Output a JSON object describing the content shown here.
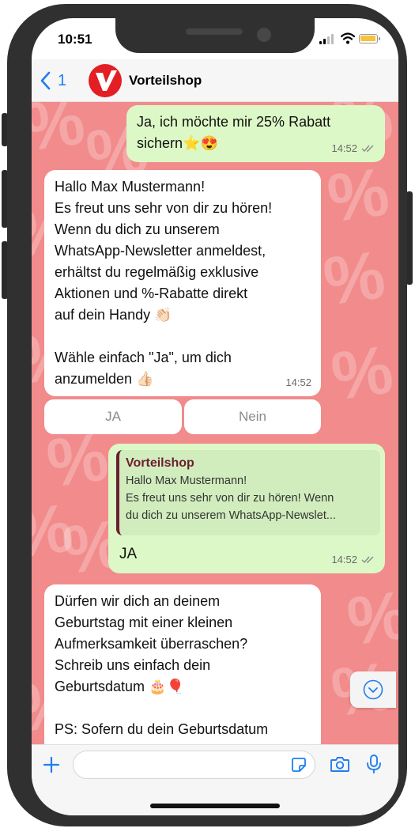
{
  "status": {
    "time": "10:51"
  },
  "header": {
    "back_count": "1",
    "contact_name": "Vorteilshop"
  },
  "messages": {
    "m1": {
      "line1": "Ja, ich möchte mir 25% Rabatt",
      "line2": "sichern⭐😍",
      "time": "14:52"
    },
    "m2": {
      "lines": [
        "Hallo Max Mustermann!",
        "Es freut uns sehr von dir zu hören!",
        "Wenn du dich zu unserem",
        "WhatsApp-Newsletter anmeldest,",
        "erhältst du regelmäßig exklusive",
        "Aktionen und %-Rabatte direkt",
        "auf dein Handy 👏🏻",
        "",
        "Wähle einfach \"Ja\", um dich",
        "anzumelden 👍🏻"
      ],
      "time": "14:52"
    },
    "quick_replies": [
      "JA",
      "Nein"
    ],
    "m3": {
      "quote_name": "Vorteilshop",
      "quote_line1": "Hallo Max Mustermann!",
      "quote_line2": "Es freut uns sehr von dir zu hören! Wenn",
      "quote_line3": "du dich zu unserem WhatsApp-Newslet...",
      "text": "JA",
      "time": "14:52"
    },
    "m4": {
      "lines": [
        "Dürfen wir dich an deinem",
        "Geburtstag mit einer kleinen",
        "Aufmerksamkeit überraschen?",
        "Schreib uns einfach dein",
        "Geburtsdatum 🎂🎈",
        "",
        "PS: Sofern du dein Geburtsdatum"
      ]
    }
  },
  "colors": {
    "chat_bg": "#f28b8b",
    "outgoing": "#dcf8c6",
    "incoming": "#ffffff",
    "accent": "#1f7ef0",
    "brand": "#e31e24"
  },
  "icons": [
    "chevron-left-icon",
    "vorteilshop-logo",
    "double-check-icon",
    "chevron-down-icon",
    "plus-icon",
    "sticker-icon",
    "camera-icon",
    "microphone-icon"
  ]
}
